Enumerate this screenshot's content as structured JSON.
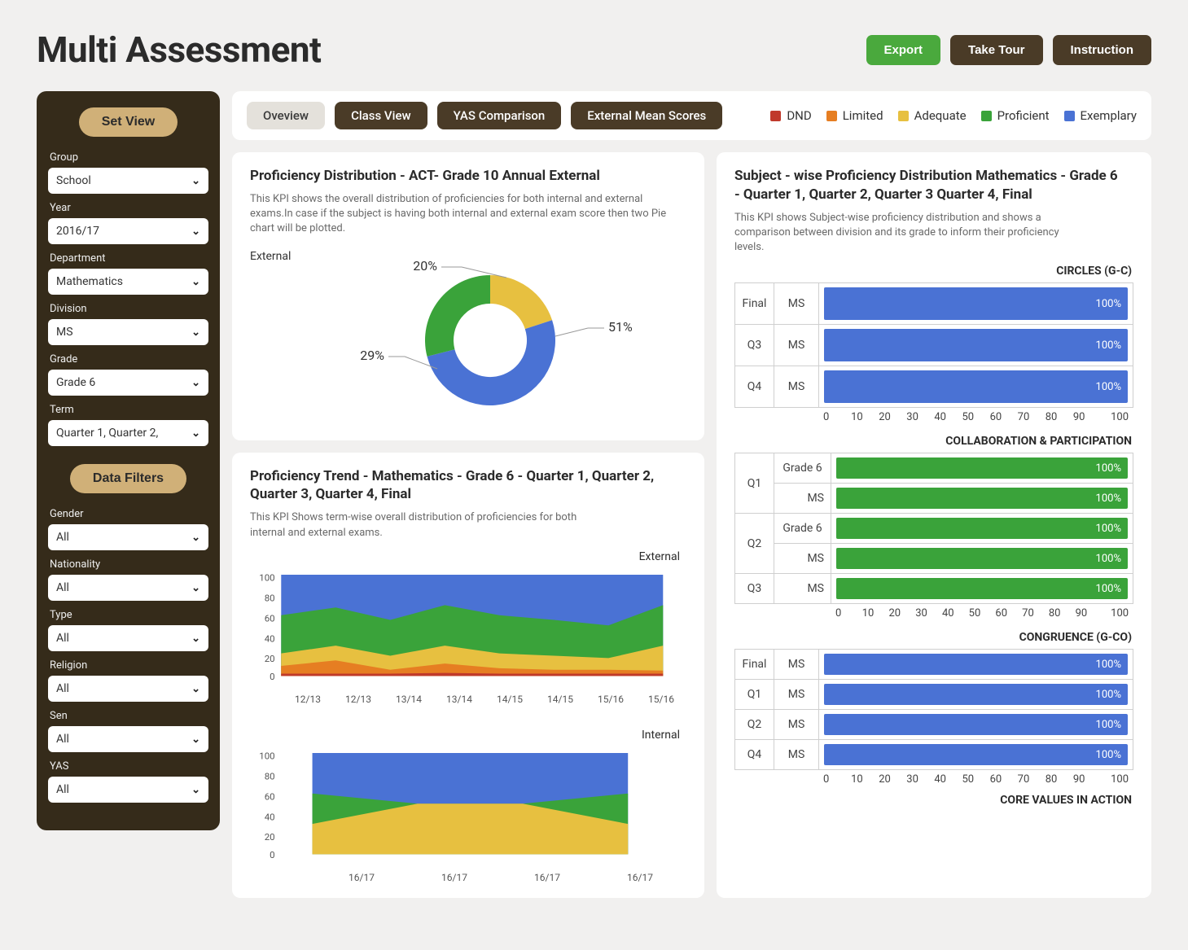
{
  "page_title": "Multi Assessment",
  "top_buttons": {
    "export": "Export",
    "tour": "Take Tour",
    "instruction": "Instruction"
  },
  "sidebar": {
    "set_view": "Set View",
    "data_filters": "Data Filters",
    "filters": {
      "group": {
        "label": "Group",
        "value": "School"
      },
      "year": {
        "label": "Year",
        "value": "2016/17"
      },
      "department": {
        "label": "Department",
        "value": "Mathematics"
      },
      "division": {
        "label": "Division",
        "value": "MS"
      },
      "grade": {
        "label": "Grade",
        "value": "Grade 6"
      },
      "term": {
        "label": "Term",
        "value": "Quarter 1, Quarter 2,"
      },
      "gender": {
        "label": "Gender",
        "value": "All"
      },
      "nationality": {
        "label": "Nationality",
        "value": "All"
      },
      "type": {
        "label": "Type",
        "value": "All"
      },
      "religion": {
        "label": "Religion",
        "value": "All"
      },
      "sen": {
        "label": "Sen",
        "value": "All"
      },
      "yas": {
        "label": "YAS",
        "value": "All"
      }
    }
  },
  "tabs": {
    "overview": "Oveview",
    "class": "Class View",
    "yas": "YAS Comparison",
    "external": "External Mean Scores"
  },
  "legend": {
    "dnd": {
      "label": "DND",
      "color": "#c0392b"
    },
    "limited": {
      "label": "Limited",
      "color": "#e67e22"
    },
    "adequate": {
      "label": "Adequate",
      "color": "#e7c040"
    },
    "proficient": {
      "label": "Proficient",
      "color": "#3aa33a"
    },
    "exemplary": {
      "label": "Exemplary",
      "color": "#4a72d4"
    }
  },
  "donut": {
    "title": "Proficiency Distribution - ACT- Grade 10 Annual External",
    "desc": "This KPI shows the overall distribution of proficiencies for both internal and external exams.In case if the subject is having both internal and external exam score then two Pie chart will be plotted.",
    "series_label": "External",
    "pct_yellow": "20%",
    "pct_blue": "51%",
    "pct_green": "29%"
  },
  "trend": {
    "title": "Proficiency Trend - Mathematics -  Grade 6 - Quarter 1, Quarter 2, Quarter 3, Quarter 4, Final",
    "desc": "This KPI Shows term-wise overall distribution of proficiencies for both internal and external exams.",
    "ext_label": "External",
    "int_label": "Internal",
    "ext_x": [
      "12/13",
      "12/13",
      "13/14",
      "13/14",
      "14/15",
      "14/15",
      "15/16",
      "15/16"
    ],
    "int_x": [
      "16/17",
      "16/17",
      "16/17",
      "16/17"
    ]
  },
  "subject": {
    "title": "Subject - wise Proficiency Distribution Mathematics -  Grade 6 - Quarter 1, Quarter 2, Quarter 3 Quarter 4, Final",
    "desc": "This KPI shows Subject-wise proficiency distribution and shows a comparison between division and its grade to inform their proficiency levels.",
    "sec1": "CIRCLES (G-C)",
    "sec2": "COLLABORATION &  PARTICIPATION",
    "sec3": "CONGRUENCE (G-CO)",
    "sec4": "CORE VALUES IN ACTION",
    "pct": "100%",
    "axis": [
      "0",
      "10",
      "20",
      "30",
      "40",
      "50",
      "60",
      "70",
      "80",
      "90",
      "100"
    ],
    "rows1": [
      {
        "r": "Final",
        "s": "MS"
      },
      {
        "r": "Q3",
        "s": "MS"
      },
      {
        "r": "Q4",
        "s": "MS"
      }
    ],
    "rows2": [
      {
        "r": "Q1",
        "s1": "Grade 6",
        "s2": "MS"
      },
      {
        "r": "Q2",
        "s1": "Grade 6",
        "s2": "MS"
      },
      {
        "r": "Q3",
        "s1": "MS"
      }
    ],
    "rows3": [
      {
        "r": "Final",
        "s": "MS"
      },
      {
        "r": "Q1",
        "s": "MS"
      },
      {
        "r": "Q2",
        "s": "MS"
      },
      {
        "r": "Q4",
        "s": "MS"
      }
    ]
  },
  "chart_data": [
    {
      "type": "pie",
      "title": "Proficiency Distribution - ACT- Grade 10 Annual External",
      "series": [
        {
          "name": "Adequate",
          "value": 20
        },
        {
          "name": "Proficient",
          "value": 29
        },
        {
          "name": "Exemplary",
          "value": 51
        }
      ]
    },
    {
      "type": "area",
      "title": "Proficiency Trend External",
      "x": [
        "12/13",
        "12/13",
        "13/14",
        "13/14",
        "14/15",
        "14/15",
        "15/16",
        "15/16"
      ],
      "ylim": [
        0,
        100
      ],
      "series": [
        {
          "name": "DND",
          "values": [
            2,
            2,
            2,
            3,
            2,
            2,
            2,
            2
          ]
        },
        {
          "name": "Limited",
          "values": [
            10,
            15,
            6,
            12,
            8,
            6,
            6,
            5
          ]
        },
        {
          "name": "Adequate",
          "values": [
            22,
            30,
            20,
            30,
            22,
            20,
            18,
            30
          ]
        },
        {
          "name": "Proficient",
          "values": [
            60,
            68,
            55,
            70,
            60,
            55,
            50,
            70
          ]
        },
        {
          "name": "Exemplary",
          "values": [
            100,
            100,
            100,
            100,
            100,
            100,
            100,
            100
          ]
        }
      ]
    },
    {
      "type": "area",
      "title": "Proficiency Trend Internal",
      "x": [
        "16/17",
        "16/17",
        "16/17",
        "16/17"
      ],
      "ylim": [
        0,
        100
      ],
      "series": [
        {
          "name": "Adequate",
          "values": [
            30,
            50,
            50,
            30
          ]
        },
        {
          "name": "Proficient",
          "values": [
            60,
            50,
            50,
            60
          ]
        },
        {
          "name": "Exemplary",
          "values": [
            100,
            100,
            100,
            100
          ]
        }
      ]
    },
    {
      "type": "bar",
      "title": "CIRCLES (G-C)",
      "categories": [
        "Final MS",
        "Q3 MS",
        "Q4 MS"
      ],
      "series": [
        {
          "name": "Exemplary",
          "values": [
            100,
            100,
            100
          ]
        }
      ],
      "xlim": [
        0,
        100
      ]
    },
    {
      "type": "bar",
      "title": "COLLABORATION & PARTICIPATION",
      "categories": [
        "Q1 Grade 6",
        "Q1 MS",
        "Q2 Grade 6",
        "Q2 MS",
        "Q3 MS"
      ],
      "series": [
        {
          "name": "Proficient",
          "values": [
            100,
            100,
            100,
            100,
            100
          ]
        }
      ],
      "xlim": [
        0,
        100
      ]
    },
    {
      "type": "bar",
      "title": "CONGRUENCE (G-CO)",
      "categories": [
        "Final MS",
        "Q1 MS",
        "Q2 MS",
        "Q4 MS"
      ],
      "series": [
        {
          "name": "Exemplary",
          "values": [
            100,
            100,
            100,
            100
          ]
        }
      ],
      "xlim": [
        0,
        100
      ]
    }
  ]
}
